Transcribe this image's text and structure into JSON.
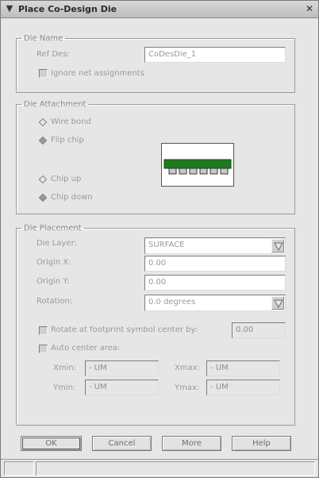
{
  "window": {
    "title": "Place Co-Design Die"
  },
  "die_name_group": {
    "legend": "Die Name",
    "ref_des_label": "Ref Des:",
    "ref_des_value": "CoDesDie_1",
    "ignore_net_label": "Ignore net assignments",
    "ignore_net_checked": false
  },
  "die_attachment_group": {
    "legend": "Die Attachment",
    "options": [
      {
        "label": "Wire bond",
        "selected": false
      },
      {
        "label": "Flip chip",
        "selected": true
      }
    ],
    "orientation_options": [
      {
        "label": "Chip up",
        "selected": false
      },
      {
        "label": "Chip down",
        "selected": true
      }
    ],
    "preview_colors": {
      "body": "#1e7a1e",
      "pads": "#c8c8c8"
    }
  },
  "die_placement_group": {
    "legend": "Die Placement",
    "die_layer_label": "Die Layer:",
    "die_layer_value": "SURFACE",
    "origin_x_label": "Origin X:",
    "origin_x_value": "0.00",
    "origin_y_label": "Origin Y:",
    "origin_y_value": "0.00",
    "rotation_label": "Rotation:",
    "rotation_value": "0.0 degrees",
    "rotate_label": "Rotate at footprint symbol center by:",
    "rotate_value": "0.00",
    "rotate_checked": false,
    "auto_center_label": "Auto center area:",
    "auto_center_checked": false,
    "area": {
      "xmin_label": "Xmin:",
      "xmin_value": "- UM",
      "xmax_label": "Xmax:",
      "xmax_value": "- UM",
      "ymin_label": "Ymin:",
      "ymin_value": "- UM",
      "ymax_label": "Ymax:",
      "ymax_value": "- UM"
    }
  },
  "buttons": {
    "ok": "OK",
    "cancel": "Cancel",
    "more": "More",
    "help": "Help"
  }
}
